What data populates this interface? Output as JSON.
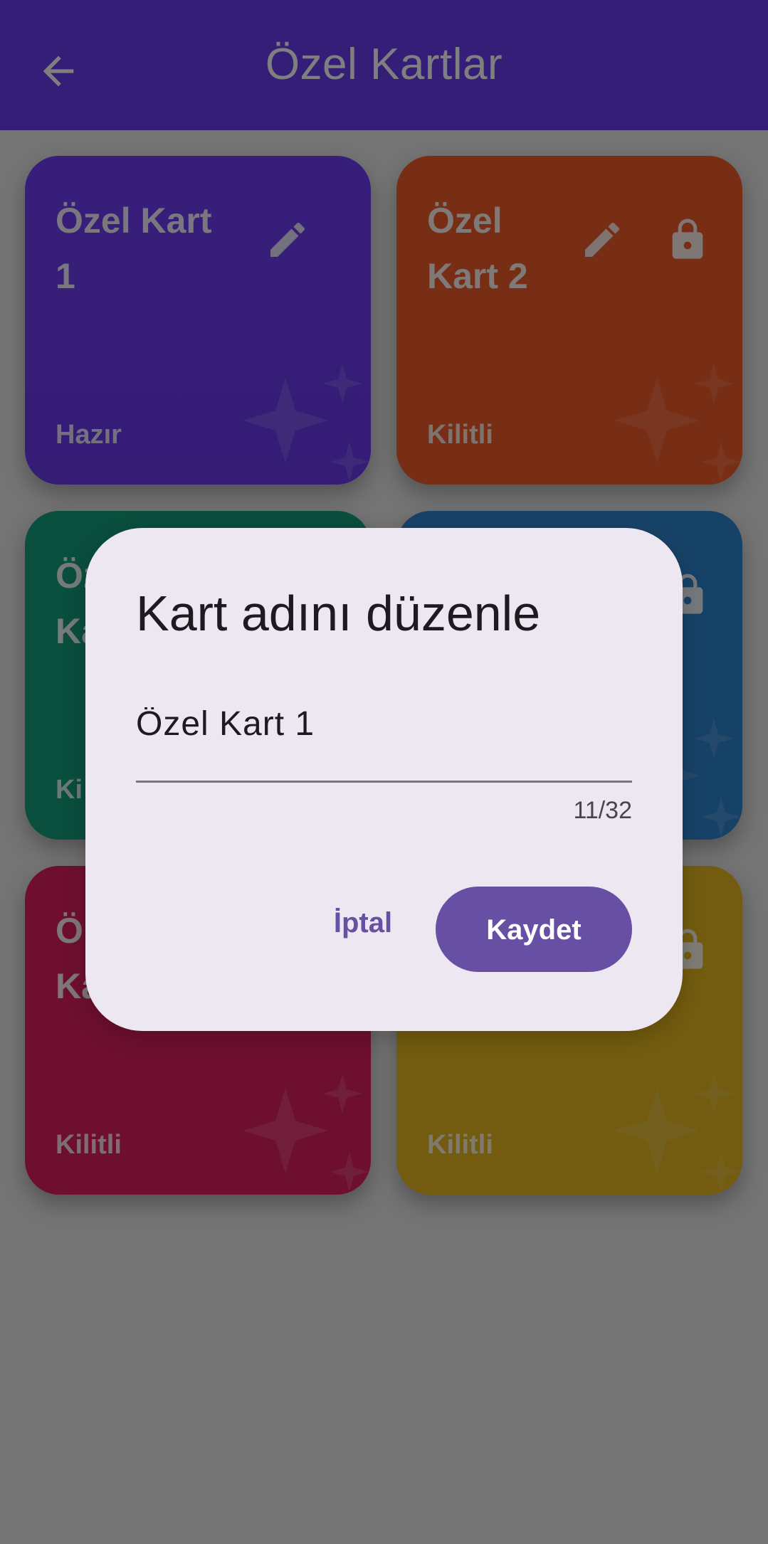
{
  "app_bar": {
    "title": "Özel Kartlar",
    "back_icon": "arrow-back-icon",
    "color": "#6b3cf1"
  },
  "cards": [
    {
      "name": "Özel Kart 1",
      "status": "Hazır",
      "color": "#6b3cf1",
      "editable": true,
      "locked": false
    },
    {
      "name": "Özel Kart 2",
      "status": "Kilitli",
      "color": "#f05a2a",
      "editable": true,
      "locked": true
    },
    {
      "name": "Öz Ka",
      "status": "Ki",
      "color": "#159c7b",
      "editable": false,
      "locked": false
    },
    {
      "name": "",
      "status": "",
      "color": "#2f84cf",
      "editable": false,
      "locked": true
    },
    {
      "name": "Ö Ka",
      "status": "Kilitli",
      "color": "#dd1f5f",
      "editable": false,
      "locked": false
    },
    {
      "name": "",
      "status": "Kilitli",
      "color": "#e6b81f",
      "editable": false,
      "locked": true
    }
  ],
  "dialog": {
    "title": "Kart adını düzenle",
    "field_value": "Özel Kart 1",
    "counter": "11/32",
    "cancel_label": "İptal",
    "save_label": "Kaydet",
    "accent_color": "#6750a4"
  }
}
